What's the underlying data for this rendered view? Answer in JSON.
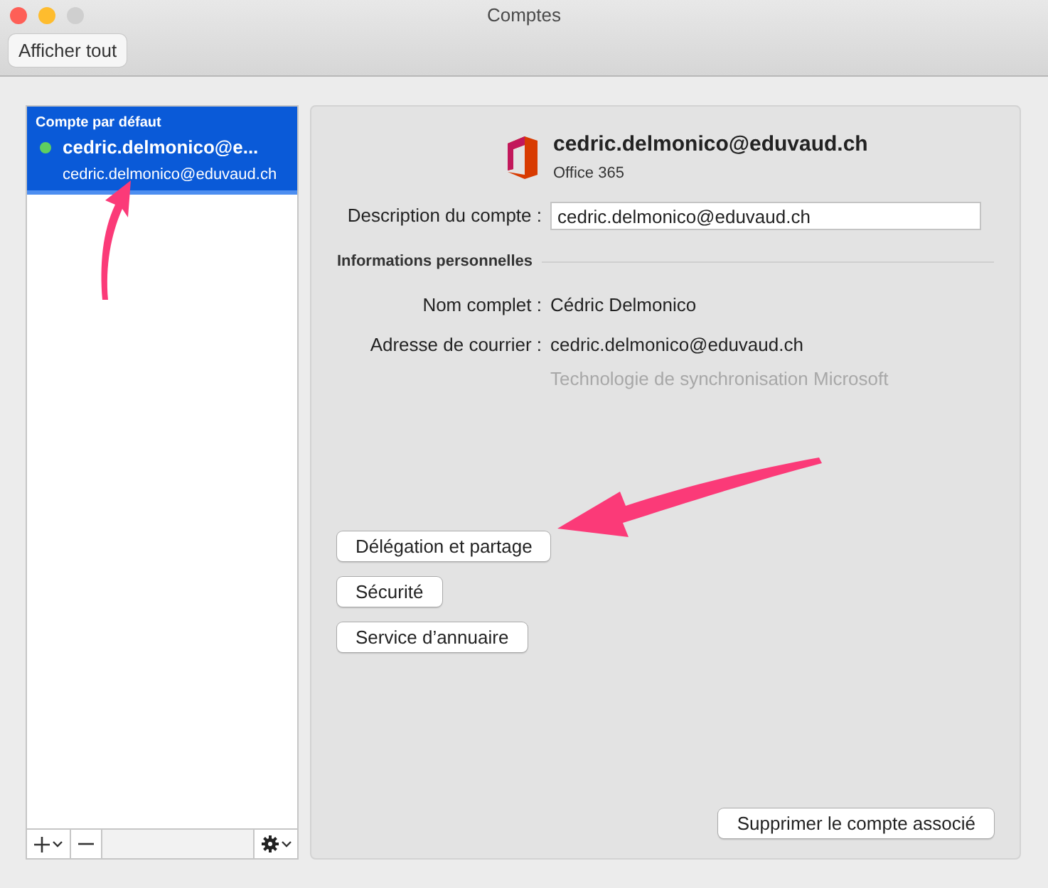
{
  "window": {
    "title": "Comptes"
  },
  "toolbar": {
    "button": "Afficher tout"
  },
  "accounts": [
    {
      "heading": "Compte par défaut",
      "name": "cedric.delmonico@e...",
      "email": "cedric.delmonico@eduvaud.ch",
      "online": true,
      "selected": true
    }
  ],
  "detail": {
    "title": "cedric.delmonico@eduvaud.ch",
    "type": "Office 365",
    "description_label": "Description du compte :",
    "description_value": "cedric.delmonico@eduvaud.ch",
    "section": "Informations personnelles",
    "fields": [
      {
        "label": "Nom complet :",
        "value": "Cédric Delmonico"
      },
      {
        "label": "Adresse de courrier :",
        "value": "cedric.delmonico@eduvaud.ch",
        "note": "Technologie de synchronisation Microsoft"
      }
    ],
    "buttons": [
      "Délégation et partage",
      "Sécurité",
      "Service d’annuaire"
    ],
    "remove_button": "Supprimer le compte associé"
  }
}
